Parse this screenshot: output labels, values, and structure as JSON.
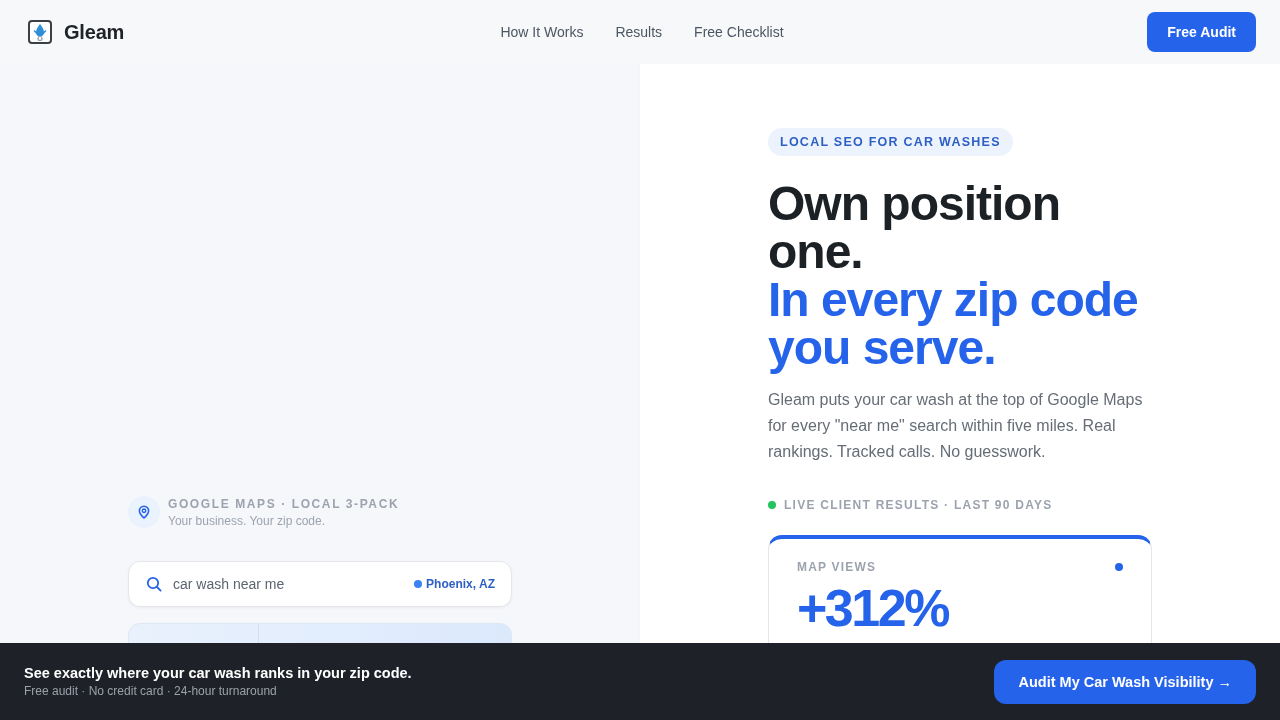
{
  "header": {
    "brand": "Gleam",
    "nav": [
      {
        "label": "How It Works"
      },
      {
        "label": "Results"
      },
      {
        "label": "Free Checklist"
      }
    ],
    "cta": "Free Audit"
  },
  "map_preview": {
    "eyebrow": "GOOGLE MAPS · LOCAL 3-PACK",
    "caption": "Your business. Your zip code.",
    "search": {
      "value": "car wash near me",
      "location": "Phoenix, AZ"
    }
  },
  "hero": {
    "badge": "LOCAL SEO FOR CAR WASHES",
    "headline": "Own position one.",
    "headline_accent": "In every zip code you serve.",
    "body": "Gleam puts your car wash at the top of Google Maps for every \"near me\" search within five miles. Real rankings. Tracked calls. No guesswork.",
    "results_label": "LIVE CLIENT RESULTS · LAST 90 DAYS",
    "stats": [
      {
        "label": "MAP VIEWS",
        "value": "+312%"
      }
    ]
  },
  "sticky_bar": {
    "title": "See exactly where your car wash ranks in your zip code.",
    "subtitle": "Free audit · No credit card · 24-hour turnaround",
    "button": "Audit My Car Wash Visibility →"
  }
}
